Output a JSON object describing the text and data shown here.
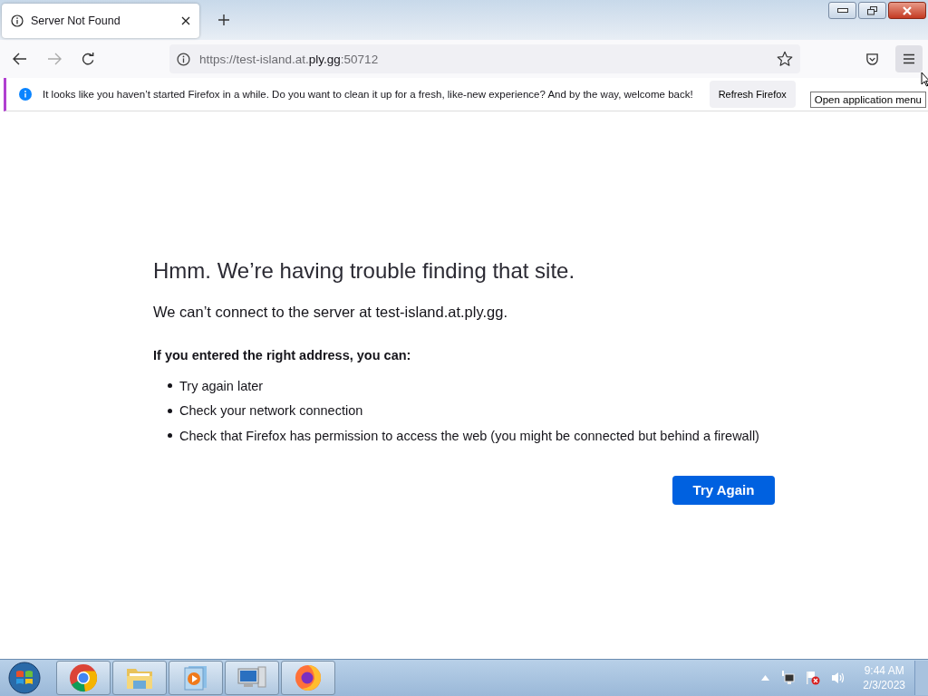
{
  "tabs": [
    {
      "title": "Server Not Found",
      "selected": true
    }
  ],
  "toolbar": {
    "url": {
      "prefix": "https://test-island.at.",
      "domain": "ply.gg",
      "suffix": ":50712"
    },
    "menu_hovered": true
  },
  "notification": {
    "message": "It looks like you haven’t started Firefox in a while. Do you want to clean it up for a fresh, like-new experience? And by the way, welcome back!",
    "button": "Refresh Firefox"
  },
  "tooltip": "Open application menu",
  "error_page": {
    "title": "Hmm. We’re having trouble finding that site.",
    "subtitle": "We can’t connect to the server at test-island.at.ply.gg.",
    "list_heading": "If you entered the right address, you can:",
    "suggestions": [
      "Try again later",
      "Check your network connection",
      "Check that Firefox has permission to access the web (you might be connected but behind a firewall)"
    ],
    "button": "Try Again"
  },
  "taskbar": {
    "apps": [
      {
        "kind": "chrome"
      },
      {
        "kind": "folder"
      },
      {
        "kind": "media"
      },
      {
        "kind": "computer"
      },
      {
        "kind": "firefox"
      }
    ],
    "time": "9:44 AM",
    "date": "2/3/2023"
  }
}
